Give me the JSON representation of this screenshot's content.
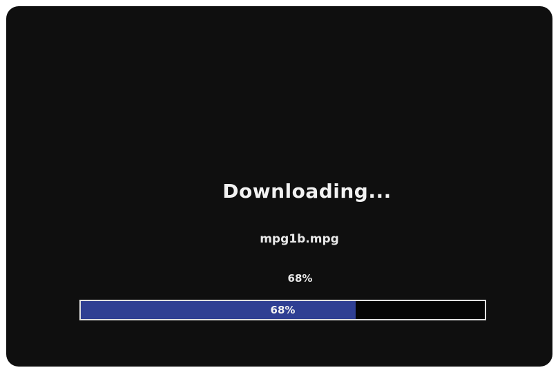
{
  "dialog": {
    "title": "Downloading...",
    "filename": "mpg1b.mpg",
    "percent_text": "68%",
    "progress": {
      "value": 0.68,
      "label": "68%",
      "fill_color": "#2f3f93",
      "track_color": "#050505",
      "border_color": "#e0e0e0"
    }
  }
}
